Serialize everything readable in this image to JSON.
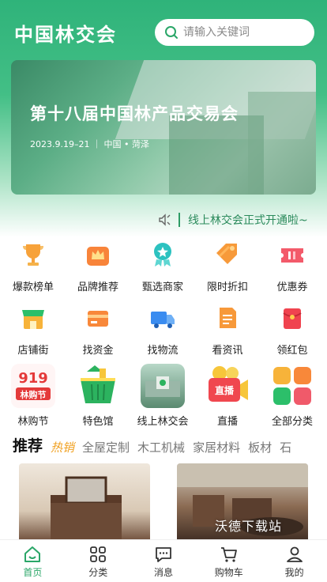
{
  "header": {
    "app_title": "中国林交会",
    "search_placeholder": "请输入关键词"
  },
  "banner": {
    "title": "第十八届中国林产品交易会",
    "subtitle": "2023.9.19–21 ｜ 中国 • 菏泽"
  },
  "notice": {
    "text": "线上林交会正式开通啦~"
  },
  "grid": {
    "items": [
      {
        "label": "爆款榜单",
        "icon": "trophy-icon"
      },
      {
        "label": "品牌推荐",
        "icon": "crown-icon"
      },
      {
        "label": "甄选商家",
        "icon": "star-badge-icon"
      },
      {
        "label": "限时折扣",
        "icon": "tag-icon"
      },
      {
        "label": "优惠券",
        "icon": "coupon-icon"
      },
      {
        "label": "店铺街",
        "icon": "shop-icon"
      },
      {
        "label": "找资金",
        "icon": "card-icon"
      },
      {
        "label": "找物流",
        "icon": "truck-icon"
      },
      {
        "label": "看资讯",
        "icon": "news-icon"
      },
      {
        "label": "领红包",
        "icon": "red-envelope-icon"
      },
      {
        "label": "林购节",
        "icon": "festival-icon",
        "image_text": "919 林购节"
      },
      {
        "label": "特色馆",
        "icon": "basket-icon"
      },
      {
        "label": "线上林交会",
        "icon": "expo-icon"
      },
      {
        "label": "直播",
        "icon": "live-icon",
        "image_text": "直播"
      },
      {
        "label": "全部分类",
        "icon": "all-categories-icon"
      }
    ]
  },
  "tabs": [
    "推荐",
    "热销",
    "全屋定制",
    "木工机械",
    "家居材料",
    "板材",
    "石"
  ],
  "watermark": "沃德下载站",
  "bottom_nav": [
    {
      "label": "首页",
      "icon": "home-icon"
    },
    {
      "label": "分类",
      "icon": "grid-icon"
    },
    {
      "label": "消息",
      "icon": "message-icon"
    },
    {
      "label": "购物车",
      "icon": "cart-icon"
    },
    {
      "label": "我的",
      "icon": "user-icon"
    }
  ],
  "colors": {
    "brand_green": "#2aa668",
    "hot_orange": "#f0a020"
  }
}
